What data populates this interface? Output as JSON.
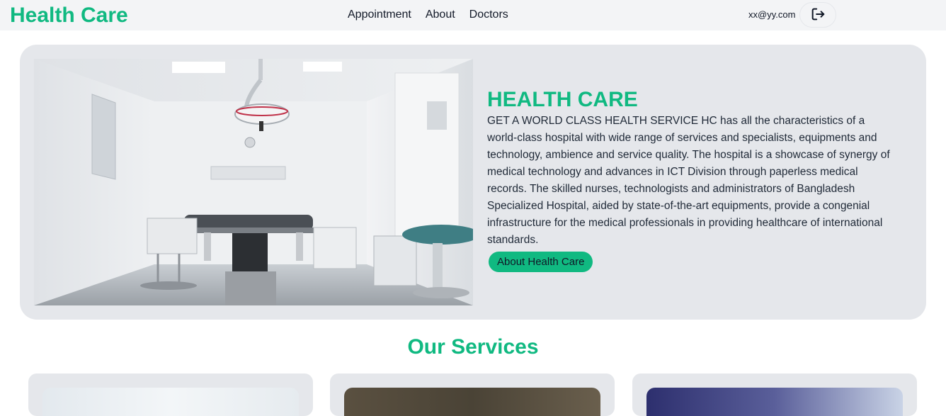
{
  "navbar": {
    "brand": "Health Care",
    "links": [
      "Appointment",
      "About",
      "Doctors"
    ],
    "user_email": "xx@yy.com",
    "logout_icon": "logout-icon"
  },
  "hero": {
    "title": "HEALTH CARE",
    "description": "GET A WORLD CLASS HEALTH SERVICE HC has all the characteristics of a world-class hospital with wide range of services and specialists, equipments and technology, ambience and service quality. The hospital is a showcase of synergy of medical technology and advances in ICT Division through paperless medical records. The skilled nurses, technologists and administrators of Bangladesh Specialized Hospital, aided by state-of-the-art equipments, provide a congenial infrastructure for the medical professionals in providing healthcare of international standards.",
    "button_label": "About Health Care"
  },
  "services": {
    "title": "Our Services"
  },
  "colors": {
    "brand": "#10b981",
    "card_bg": "#e5e7eb",
    "navbar_bg": "#f3f4f6"
  }
}
